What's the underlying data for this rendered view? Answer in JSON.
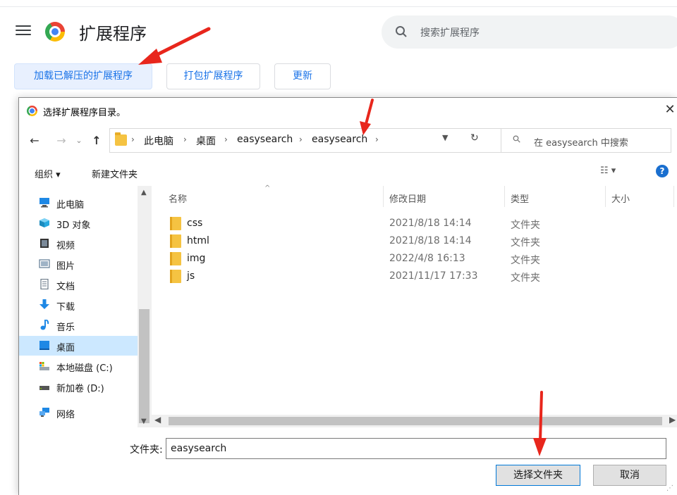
{
  "page": {
    "title": "扩展程序",
    "search_placeholder": "搜索扩展程序",
    "buttons": {
      "load_unpacked": "加载已解压的扩展程序",
      "pack": "打包扩展程序",
      "update": "更新"
    }
  },
  "dialog": {
    "title": "选择扩展程序目录。",
    "close_glyph": "✕",
    "nav": {
      "back": "←",
      "forward": "→",
      "recent": "⌄",
      "up": "↑"
    },
    "breadcrumb": [
      "此电脑",
      "桌面",
      "easysearch",
      "easysearch"
    ],
    "breadcrumb_sep": "›",
    "search_placeholder": "在 easysearch 中搜索",
    "toolbar": {
      "organize": "组织 ▾",
      "new_folder": "新建文件夹",
      "view": "☷ ▾",
      "help": "?"
    },
    "nav_pane": [
      {
        "label": "此电脑",
        "icon": "computer-icon",
        "color": "#1e88e5"
      },
      {
        "label": "3D 对象",
        "icon": "cube-icon",
        "color": "#26a9e0"
      },
      {
        "label": "视频",
        "icon": "video-icon",
        "color": "#333333"
      },
      {
        "label": "图片",
        "icon": "picture-icon",
        "color": "#5f7a93"
      },
      {
        "label": "文档",
        "icon": "document-icon",
        "color": "#6b7a88"
      },
      {
        "label": "下载",
        "icon": "download-icon",
        "color": "#1e88e5"
      },
      {
        "label": "音乐",
        "icon": "music-icon",
        "color": "#1e88e5"
      },
      {
        "label": "桌面",
        "icon": "desktop-icon",
        "color": "#1e88e5",
        "selected": true
      },
      {
        "label": "本地磁盘 (C:)",
        "icon": "drive-c-icon",
        "color": "#4a90d9"
      },
      {
        "label": "新加卷 (D:)",
        "icon": "drive-d-icon",
        "color": "#555555"
      },
      {
        "label": "网络",
        "icon": "network-icon",
        "color": "#1e88e5"
      }
    ],
    "columns": [
      "名称",
      "修改日期",
      "类型",
      "大小"
    ],
    "files": [
      {
        "name": "css",
        "date": "2021/8/18 14:14",
        "type": "文件夹"
      },
      {
        "name": "html",
        "date": "2021/8/18 14:14",
        "type": "文件夹"
      },
      {
        "name": "img",
        "date": "2022/4/8 16:13",
        "type": "文件夹"
      },
      {
        "name": "js",
        "date": "2021/11/17 17:33",
        "type": "文件夹"
      }
    ],
    "folder_label": "文件夹:",
    "folder_value": "easysearch",
    "buttons": {
      "select_folder": "选择文件夹",
      "cancel": "取消"
    }
  },
  "colors": {
    "accent": "#1a73e8",
    "annotation": "#e8261c",
    "selection": "#cce8ff"
  }
}
